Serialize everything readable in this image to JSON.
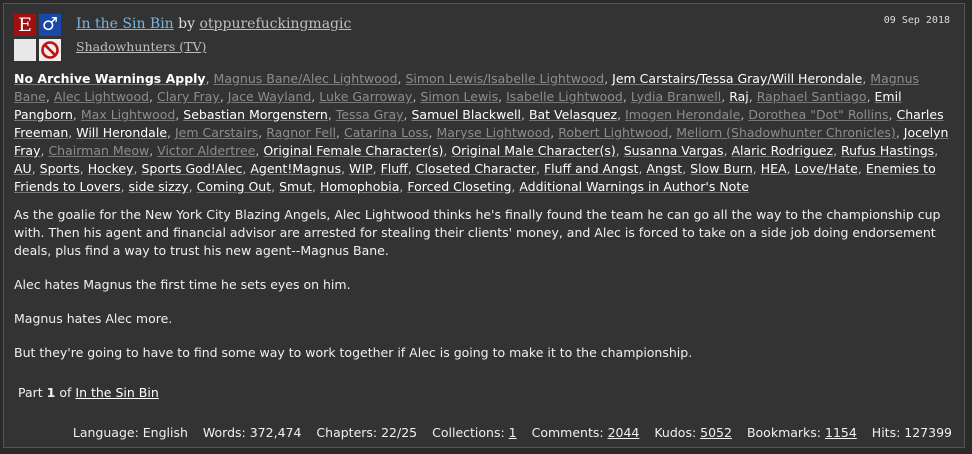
{
  "work": {
    "title": "In the Sin Bin",
    "by": "by",
    "author": "otppurefuckingmagic",
    "fandom": "Shadowhunters (TV)",
    "date": "09 Sep 2018",
    "icons": {
      "rating": "E",
      "category": "♂",
      "warning": "warning-blank-icon",
      "complete": "incomplete-icon"
    }
  },
  "tags": [
    {
      "text": "No Archive Warnings Apply",
      "kind": "warn"
    },
    {
      "text": "Magnus Bane/Alec Lightwood",
      "kind": "rel-dim"
    },
    {
      "text": "Simon Lewis/Isabelle Lightwood",
      "kind": "rel-dim"
    },
    {
      "text": "Jem Carstairs/Tessa Gray/Will Herondale",
      "kind": "rel"
    },
    {
      "text": "Magnus Bane",
      "kind": "char"
    },
    {
      "text": "Alec Lightwood",
      "kind": "char"
    },
    {
      "text": "Clary Fray",
      "kind": "char"
    },
    {
      "text": "Jace Wayland",
      "kind": "char"
    },
    {
      "text": "Luke Garroway",
      "kind": "char"
    },
    {
      "text": "Simon Lewis",
      "kind": "char"
    },
    {
      "text": "Isabelle Lightwood",
      "kind": "char"
    },
    {
      "text": "Lydia Branwell",
      "kind": "char"
    },
    {
      "text": "Raj",
      "kind": "free"
    },
    {
      "text": "Raphael Santiago",
      "kind": "char"
    },
    {
      "text": "Emil Pangborn",
      "kind": "free"
    },
    {
      "text": "Max Lightwood",
      "kind": "char"
    },
    {
      "text": "Sebastian Morgenstern",
      "kind": "free"
    },
    {
      "text": "Tessa Gray",
      "kind": "char"
    },
    {
      "text": "Samuel Blackwell",
      "kind": "free"
    },
    {
      "text": "Bat Velasquez",
      "kind": "free"
    },
    {
      "text": "Imogen Herondale",
      "kind": "char"
    },
    {
      "text": "Dorothea \"Dot\" Rollins",
      "kind": "char"
    },
    {
      "text": "Charles Freeman",
      "kind": "free"
    },
    {
      "text": "Will Herondale",
      "kind": "free"
    },
    {
      "text": "Jem Carstairs",
      "kind": "char"
    },
    {
      "text": "Ragnor Fell",
      "kind": "char"
    },
    {
      "text": "Catarina Loss",
      "kind": "char"
    },
    {
      "text": "Maryse Lightwood",
      "kind": "char"
    },
    {
      "text": "Robert Lightwood",
      "kind": "char"
    },
    {
      "text": "Meliorn (Shadowhunter Chronicles)",
      "kind": "char"
    },
    {
      "text": "Jocelyn Fray",
      "kind": "free"
    },
    {
      "text": "Chairman Meow",
      "kind": "char"
    },
    {
      "text": "Victor Aldertree",
      "kind": "char"
    },
    {
      "text": "Original Female Character(s)",
      "kind": "free"
    },
    {
      "text": "Original Male Character(s)",
      "kind": "free"
    },
    {
      "text": "Susanna Vargas",
      "kind": "free"
    },
    {
      "text": "Alaric Rodriguez",
      "kind": "free"
    },
    {
      "text": "Rufus Hastings",
      "kind": "free"
    },
    {
      "text": "AU",
      "kind": "free"
    },
    {
      "text": "Sports",
      "kind": "free"
    },
    {
      "text": "Hockey",
      "kind": "free"
    },
    {
      "text": "Sports God!Alec",
      "kind": "free"
    },
    {
      "text": "Agent!Magnus",
      "kind": "free"
    },
    {
      "text": "WIP",
      "kind": "free"
    },
    {
      "text": "Fluff",
      "kind": "free"
    },
    {
      "text": "Closeted Character",
      "kind": "free"
    },
    {
      "text": "Fluff and Angst",
      "kind": "free"
    },
    {
      "text": "Angst",
      "kind": "free"
    },
    {
      "text": "Slow Burn",
      "kind": "free"
    },
    {
      "text": "HEA",
      "kind": "free"
    },
    {
      "text": "Love/Hate",
      "kind": "free"
    },
    {
      "text": "Enemies to Friends to Lovers",
      "kind": "free"
    },
    {
      "text": "side sizzy",
      "kind": "free"
    },
    {
      "text": "Coming Out",
      "kind": "free"
    },
    {
      "text": "Smut",
      "kind": "free"
    },
    {
      "text": "Homophobia",
      "kind": "free"
    },
    {
      "text": "Forced Closeting",
      "kind": "free"
    },
    {
      "text": "Additional Warnings in Author's Note",
      "kind": "free"
    }
  ],
  "summary": [
    "As the goalie for the New York City Blazing Angels, Alec Lightwood thinks he's finally found the team he can go all the way to the championship cup with. Then his agent and financial advisor are arrested for stealing their clients' money, and Alec is forced to take on a side job doing endorsement deals, plus find a way to trust his new agent--Magnus Bane.",
    "Alec hates Magnus the first time he sets eyes on him.",
    "Magnus hates Alec more.",
    "But they're going to have to find some way to work together if Alec is going to make it to the championship."
  ],
  "series": {
    "part_label": "Part",
    "part_num": "1",
    "of": "of",
    "name": "In the Sin Bin"
  },
  "stats": {
    "language_label": "Language:",
    "language": "English",
    "words_label": "Words:",
    "words": "372,474",
    "chapters_label": "Chapters:",
    "chapters": "22/25",
    "collections_label": "Collections:",
    "collections": "1",
    "comments_label": "Comments:",
    "comments": "2044",
    "kudos_label": "Kudos:",
    "kudos": "5052",
    "bookmarks_label": "Bookmarks:",
    "bookmarks": "1154",
    "hits_label": "Hits:",
    "hits": "127399"
  }
}
